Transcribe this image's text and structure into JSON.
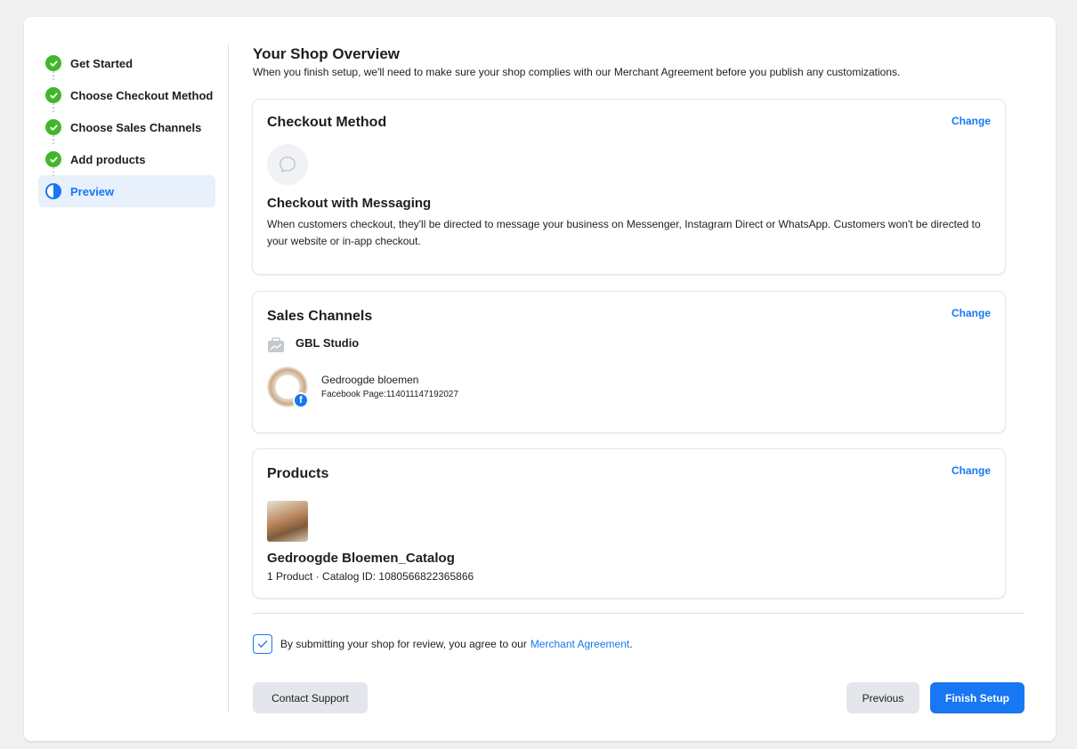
{
  "sidebar": {
    "steps": [
      {
        "label": "Get Started",
        "state": "complete"
      },
      {
        "label": "Choose Checkout Method",
        "state": "complete"
      },
      {
        "label": "Choose Sales Channels",
        "state": "complete"
      },
      {
        "label": "Add products",
        "state": "complete"
      },
      {
        "label": "Preview",
        "state": "current"
      }
    ]
  },
  "main": {
    "title": "Your Shop Overview",
    "subtitle": "When you finish setup, we'll need to make sure your shop complies with our Merchant Agreement before you publish any customizations."
  },
  "checkout_card": {
    "title": "Checkout Method",
    "change_label": "Change",
    "icon": "message-bubble-icon",
    "method_name": "Checkout with Messaging",
    "method_desc": "When customers checkout, they'll be directed to message your business on Messenger, Instagram Direct or WhatsApp. Customers won't be directed to your website or in-app checkout."
  },
  "sales_card": {
    "title": "Sales Channels",
    "change_label": "Change",
    "business_icon": "briefcase-icon",
    "business_name": "GBL Studio",
    "page_name": "Gedroogde bloemen",
    "page_id": "Facebook Page:114011147192027",
    "badge_glyph": "f"
  },
  "products_card": {
    "title": "Products",
    "change_label": "Change",
    "catalog_name": "Gedroogde Bloemen_Catalog",
    "catalog_meta": "1 Product · Catalog ID: 1080566822365866"
  },
  "agreement": {
    "checked": true,
    "text": "By submitting your shop for review, you agree to our ",
    "link": "Merchant Agreement",
    "suffix": "."
  },
  "buttons": {
    "contact": "Contact Support",
    "previous": "Previous",
    "finish": "Finish Setup"
  },
  "colors": {
    "accent": "#1877f2",
    "success": "#42b72a",
    "background": "#f0f0f0"
  }
}
